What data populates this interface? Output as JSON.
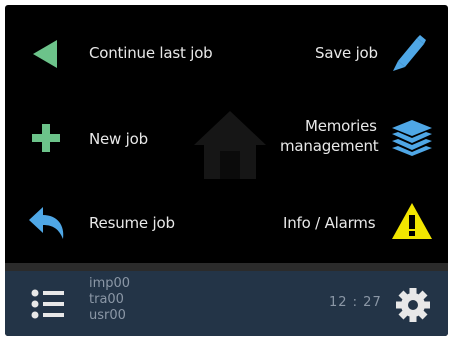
{
  "menu": {
    "continue_label": "Continue last job",
    "new_label": "New job",
    "resume_label": "Resume job",
    "save_label": "Save job",
    "memories_label_line1": "Memories",
    "memories_label_line2": "management",
    "info_label": "Info / Alarms"
  },
  "status": {
    "users": [
      "imp00",
      "tra00",
      "usr00"
    ],
    "time": "12 : 27"
  },
  "icons": {
    "continue": "play-left-triangle-icon",
    "new": "plus-icon",
    "resume": "back-arrow-icon",
    "save": "pencil-icon",
    "memories": "layers-stack-icon",
    "info": "warning-triangle-icon",
    "home": "home-icon",
    "list": "list-icon",
    "settings": "gear-icon"
  },
  "colors": {
    "screen_bg": "#000000",
    "bar_bg": "#233447",
    "green": "#6cc38a",
    "blue": "#4fa7e6",
    "yellow": "#f2e600",
    "text": "#e8e8e8",
    "muted_text": "#8b97a6"
  }
}
